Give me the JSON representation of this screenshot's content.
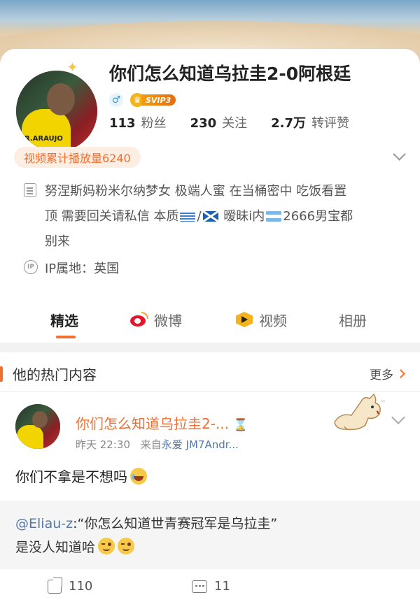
{
  "profile": {
    "name": "你们怎么知道乌拉圭2-0阿根廷",
    "gender_symbol": "♂",
    "vip_label": "SVIP3",
    "stats": [
      {
        "value": "113",
        "label": "粉丝"
      },
      {
        "value": "230",
        "label": "关注"
      },
      {
        "value": "2.7万",
        "label": "转评赞"
      }
    ],
    "play_count": "视频累计播放量6240",
    "bio_line1": "努涅斯妈粉米尔纳梦女 极端人蜜 在当桶密中 吃饭看置",
    "bio_line2_a": "顶 需要回关请私信 本质",
    "bio_line2_sep": "/",
    "bio_line2_b": " 暧昧i内",
    "bio_line2_c": "2666男宝都",
    "bio_line3": "别来",
    "ip_badge": "IP",
    "ip_location": "IP属地：英国",
    "avatar_text": "R.ARAUJO"
  },
  "tabs": [
    {
      "label": "精选"
    },
    {
      "label": "微博"
    },
    {
      "label": "视频"
    },
    {
      "label": "相册"
    }
  ],
  "hot_section": {
    "title": "他的热门内容",
    "more_label": "更多"
  },
  "post": {
    "author": "你们怎么知道乌拉圭2-...",
    "hourglass": "⌛",
    "time": "昨天 22:30",
    "source_prefix": "来自",
    "source": "永爱 JM7Andr...",
    "text": "你们不拿是不想吗",
    "quote_at": "@Eliau-z",
    "quote_line1": ":“你怎么知道世青赛冠军是乌拉圭”",
    "quote_line2": "是没人知道哈",
    "reposts": "110",
    "comments": "11"
  },
  "colors": {
    "accent": "#f0702f",
    "link": "#5477a8",
    "weibo_red": "#e6162d"
  }
}
